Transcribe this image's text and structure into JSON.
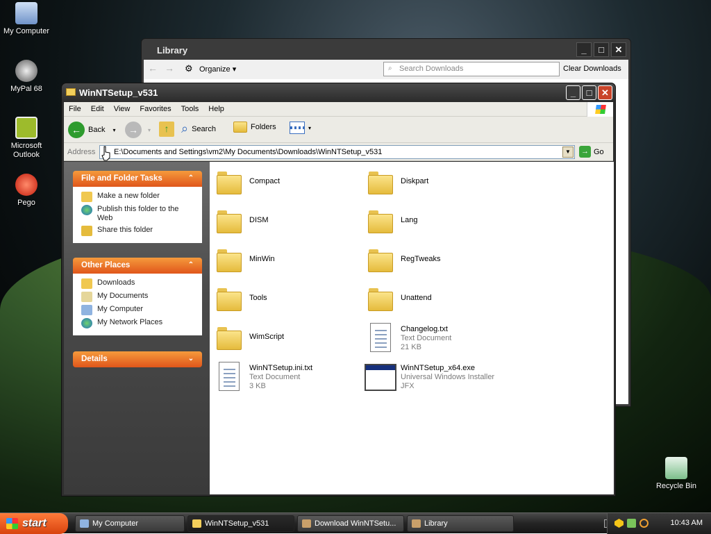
{
  "desktop": {
    "icons": [
      "My Computer",
      "MyPal 68",
      "Microsoft Outlook",
      "Pego",
      "Recycle Bin"
    ]
  },
  "library": {
    "title": "Library",
    "organize": "Organize",
    "search_placeholder": "Search Downloads",
    "clear": "Clear Downloads"
  },
  "window": {
    "title": "WinNTSetup_v531",
    "menu": [
      "File",
      "Edit",
      "View",
      "Favorites",
      "Tools",
      "Help"
    ],
    "toolbar": {
      "back": "Back",
      "search": "Search",
      "folders": "Folders"
    },
    "address_label": "Address",
    "address": "E:\\Documents and Settings\\vm2\\My Documents\\Downloads\\WinNTSetup_v531",
    "go": "Go"
  },
  "sidebar": {
    "tasks_title": "File and Folder Tasks",
    "tasks": [
      "Make a new folder",
      "Publish this folder to the Web",
      "Share this folder"
    ],
    "places_title": "Other Places",
    "places": [
      "Downloads",
      "My Documents",
      "My Computer",
      "My Network Places"
    ],
    "details_title": "Details"
  },
  "files": {
    "f1": "Compact",
    "f2": "Diskpart",
    "f3": "DISM",
    "f4": "Lang",
    "f5": "MinWin",
    "f6": "RegTweaks",
    "f7": "Tools",
    "f8": "Unattend",
    "f9": "WimScript",
    "changelog": {
      "name": "Changelog.txt",
      "type": "Text Document",
      "size": "21 KB"
    },
    "ini": {
      "name": "WinNTSetup.ini.txt",
      "type": "Text Document",
      "size": "3 KB"
    },
    "exe": {
      "name": "WinNTSetup_x64.exe",
      "type": "Universal Windows Installer",
      "company": "JFX"
    }
  },
  "taskbar": {
    "start": "start",
    "buttons": [
      "My Computer",
      "WinNTSetup_v531",
      "Download WinNTSetu...",
      "Library"
    ],
    "clock": "10:43 AM"
  }
}
